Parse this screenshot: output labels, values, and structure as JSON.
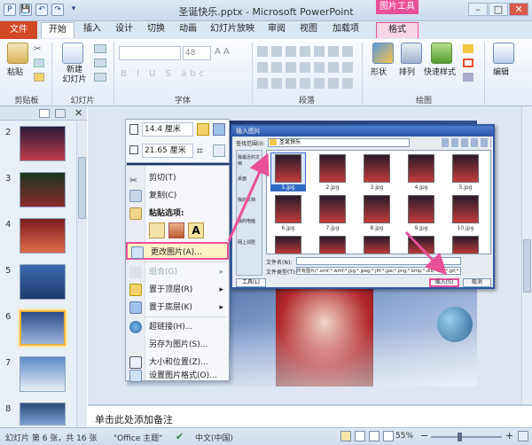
{
  "window": {
    "title": "圣诞快乐.pptx - Microsoft PowerPoint",
    "context_tab_group": "图片工具",
    "minimize": "–",
    "maximize": "□",
    "close": "✕"
  },
  "quick_access": [
    "P",
    "💾",
    "↶",
    "↷",
    "▾"
  ],
  "tabs": [
    {
      "label": "文件",
      "active": false
    },
    {
      "label": "开始",
      "active": true
    },
    {
      "label": "插入",
      "active": false
    },
    {
      "label": "设计",
      "active": false
    },
    {
      "label": "切换",
      "active": false
    },
    {
      "label": "动画",
      "active": false
    },
    {
      "label": "幻灯片放映",
      "active": false
    },
    {
      "label": "审阅",
      "active": false
    },
    {
      "label": "视图",
      "active": false
    },
    {
      "label": "加载项",
      "active": false
    },
    {
      "label": "格式",
      "active": false
    }
  ],
  "ribbon": {
    "paste": "粘贴",
    "new_slide": "新建\n幻灯片",
    "clipboard": "剪贴板",
    "slides": "幻灯片",
    "font": "字体",
    "paragraph": "段落",
    "drawing": "绘图",
    "font_size": "48",
    "shape": "形状",
    "arrange": "排列",
    "quick_styles": "快速样式",
    "edit": "编辑"
  },
  "slides": [
    {
      "num": "2",
      "selected": false
    },
    {
      "num": "3",
      "selected": false
    },
    {
      "num": "4",
      "selected": false
    },
    {
      "num": "5",
      "selected": false
    },
    {
      "num": "6",
      "selected": true
    },
    {
      "num": "7",
      "selected": false
    },
    {
      "num": "8",
      "selected": false
    }
  ],
  "mini_toolbar": {
    "height": "14.4 厘米",
    "width": "21.65 厘米"
  },
  "context_menu": [
    {
      "label": "剪切(T)",
      "disabled": false
    },
    {
      "label": "复制(C)",
      "disabled": false
    },
    {
      "label": "粘贴选项:",
      "disabled": false
    },
    {
      "label": "更改图片(A)...",
      "disabled": false,
      "highlight": true
    },
    {
      "label": "组合(G)",
      "disabled": true
    },
    {
      "label": "置于顶层(R)",
      "disabled": false
    },
    {
      "label": "置于底层(K)",
      "disabled": false
    },
    {
      "label": "超链接(H)...",
      "disabled": false
    },
    {
      "label": "另存为图片(S)...",
      "disabled": false
    },
    {
      "label": "大小和位置(Z)...",
      "disabled": false
    },
    {
      "label": "设置图片格式(O)...",
      "disabled": false
    }
  ],
  "dialog": {
    "title": "插入图片",
    "lookin_label": "查找范围(I):",
    "folder": "圣诞快乐",
    "files": [
      "1.jpg",
      "2.jpg",
      "3.jpg",
      "4.jpg",
      "5.jpg",
      "6.jpg",
      "7.jpg",
      "8.jpg",
      "9.jpg",
      "10.jpg",
      "11.jpg",
      "12.jpg",
      "13.jpg",
      "14.jpg",
      "15.jpg"
    ],
    "filename_label": "文件名(N):",
    "filetype_label": "文件类型(T):",
    "filetype_value": "所有图片(*.emf;*.wmf;*.jpg;*.jpeg;*.jfif;*.jpe;*.png;*.bmp;*.dib;*.rle;*.gif;*.e",
    "tools": "工具(L)",
    "insert": "插入(S)",
    "cancel": "取消",
    "places": [
      "我最近的文档",
      "桌面",
      "我的文档",
      "我的电脑",
      "网上邻居"
    ]
  },
  "notes_placeholder": "单击此处添加备注",
  "status": {
    "slide_info": "幻灯片 第 6 张，共 16 张",
    "theme": "\"Office 主题\"",
    "language": "中文(中国)",
    "zoom": "55%"
  },
  "colors": {
    "accent_pink": "#e8509a",
    "file_tab": "#d24726",
    "title_blue": "#2b56a8"
  }
}
